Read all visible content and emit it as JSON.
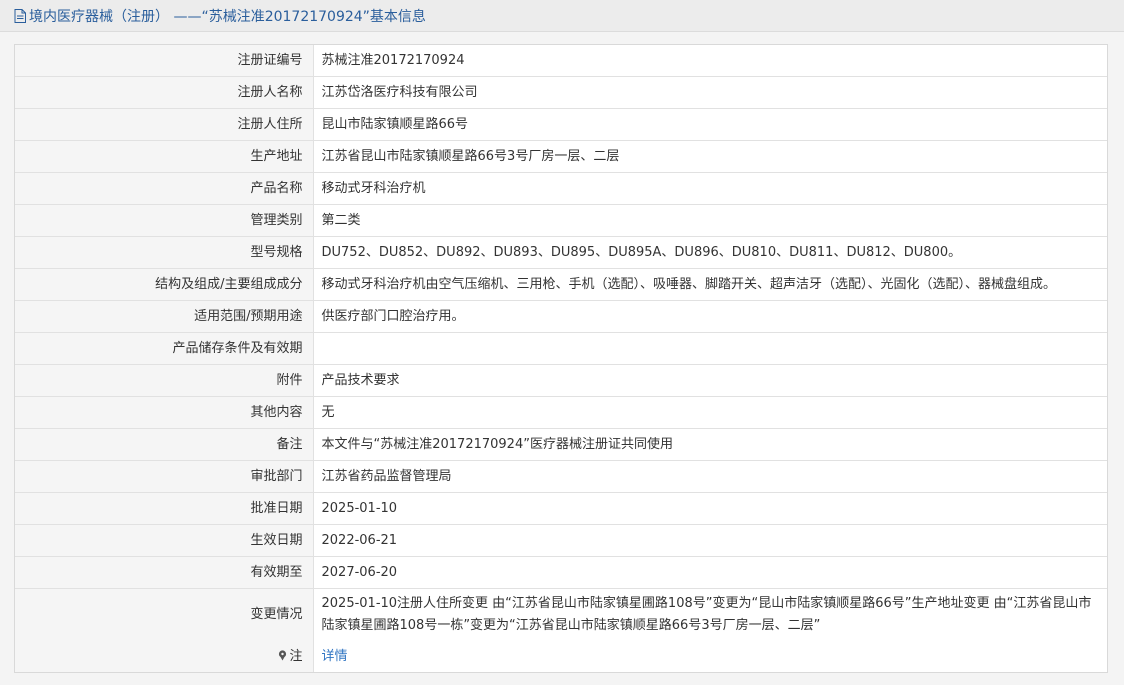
{
  "header": {
    "title": "境内医疗器械（注册） ——“苏械注准20172170924”基本信息",
    "icon": "document-icon"
  },
  "rows": [
    {
      "key": "reg_no",
      "label": "注册证编号",
      "value": "苏械注准20172170924"
    },
    {
      "key": "registrant",
      "label": "注册人名称",
      "value": "江苏岱洛医疗科技有限公司"
    },
    {
      "key": "registrant_address",
      "label": "注册人住所",
      "value": "昆山市陆家镇顺星路66号"
    },
    {
      "key": "production_address",
      "label": "生产地址",
      "value": "江苏省昆山市陆家镇顺星路66号3号厂房一层、二层"
    },
    {
      "key": "product_name",
      "label": "产品名称",
      "value": "移动式牙科治疗机"
    },
    {
      "key": "category",
      "label": "管理类别",
      "value": "第二类"
    },
    {
      "key": "models",
      "label": "型号规格",
      "value": "DU752、DU852、DU892、DU893、DU895、DU895A、DU896、DU810、DU811、DU812、DU800。"
    },
    {
      "key": "composition",
      "label": "结构及组成/主要组成成分",
      "value": "移动式牙科治疗机由空气压缩机、三用枪、手机（选配）、吸唾器、脚踏开关、超声洁牙（选配）、光固化（选配）、器械盘组成。"
    },
    {
      "key": "scope",
      "label": "适用范围/预期用途",
      "value": "供医疗部门口腔治疗用。"
    },
    {
      "key": "storage",
      "label": "产品储存条件及有效期",
      "value": ""
    },
    {
      "key": "attachment",
      "label": "附件",
      "value": "产品技术要求"
    },
    {
      "key": "other",
      "label": "其他内容",
      "value": "无"
    },
    {
      "key": "remark",
      "label": "备注",
      "value": "本文件与“苏械注准20172170924”医疗器械注册证共同使用"
    },
    {
      "key": "approval_dept",
      "label": "审批部门",
      "value": "江苏省药品监督管理局"
    },
    {
      "key": "approval_date",
      "label": "批准日期",
      "value": "2025-01-10"
    },
    {
      "key": "effective_date",
      "label": "生效日期",
      "value": "2022-06-21"
    },
    {
      "key": "expiry_date",
      "label": "有效期至",
      "value": "2027-06-20"
    },
    {
      "key": "changes",
      "label": "变更情况",
      "value": "2025-01-10注册人住所变更 由“江苏省昆山市陆家镇星圃路108号”变更为“昆山市陆家镇顺星路66号”生产地址变更 由“江苏省昆山市陆家镇星圃路108号一栋”变更为“江苏省昆山市陆家镇顺星路66号3号厂房一层、二层”"
    }
  ],
  "note": {
    "label": "注",
    "link_text": "详情",
    "icon": "pin-icon"
  },
  "colors": {
    "title": "#2a5e9c",
    "link": "#2f74c2",
    "label_bg": "#f5f5f5",
    "border": "#e1e1e1"
  }
}
